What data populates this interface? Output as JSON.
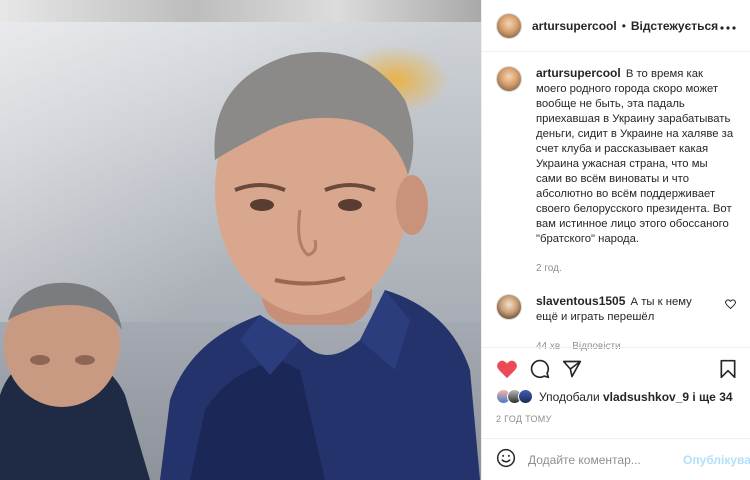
{
  "post": {
    "author": "artursupercool",
    "dot": "•",
    "follow_status": "Відстежується",
    "more_icon": "more-horizontal-icon"
  },
  "caption": {
    "author": "artursupercool",
    "text": "В то время как моего родного города скоро может вообще не быть, эта падаль приехавшая в Украину зарабатывать деньги, сидит в Украине на халяве за счет клуба и рассказывает какая Украина ужасная страна, что мы сами во всём виноваты и что абсолютно во всём поддерживает своего белорусского президента. Вот вам истинное лицо этого обоссаного \"братского\" народа.",
    "time": "2 год."
  },
  "comments": [
    {
      "author": "slaventous1505",
      "text": "А ты к нему ещё и играть перешёл",
      "time": "44 хв",
      "reply_label": "Відповісти"
    }
  ],
  "actions": {
    "icons": [
      "heart-filled-icon",
      "comment-icon",
      "share-icon",
      "bookmark-icon"
    ],
    "like_color": "#ed4956"
  },
  "likes": {
    "prefix": "Уподобали",
    "user": "vladsushkov_9",
    "suffix": "і ще 34"
  },
  "post_time": "2 ГОД ТОМУ",
  "add_comment": {
    "placeholder": "Додайте коментар...",
    "publish_label": "Опублікувати",
    "publish_color": "#b2dffc"
  }
}
